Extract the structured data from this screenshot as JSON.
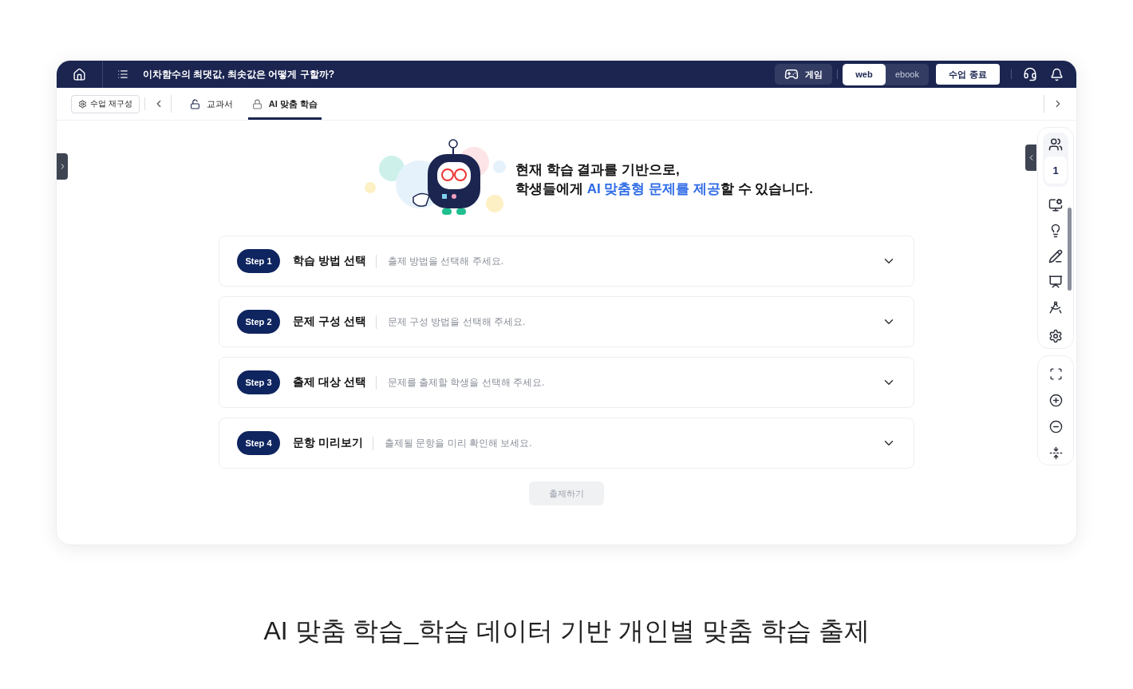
{
  "topbar": {
    "title": "이차함수의 최댓값, 최솟값은 어떻게 구할까?",
    "game_label": "게임",
    "views": [
      {
        "label": "web",
        "selected": true
      },
      {
        "label": "ebook",
        "selected": false
      }
    ],
    "end_button": "수업 종료"
  },
  "tabbar": {
    "reconfigure": "수업 재구성",
    "tabs": [
      {
        "label": "교과서",
        "selected": false,
        "locked": false
      },
      {
        "label": "AI 맞춤 학습",
        "selected": true,
        "locked": true
      }
    ]
  },
  "hero": {
    "line1": "현재 학습 결과를 기반으로,",
    "line2": [
      {
        "text": "학생들에게 ",
        "highlight": false
      },
      {
        "text": "AI 맞춤형 문제를 제공",
        "highlight": true
      },
      {
        "text": "할 수 있습니다.",
        "highlight": false
      }
    ]
  },
  "steps": [
    {
      "badge": "Step 1",
      "title": "학습 방법 선택",
      "hint": "출제 방법을 선택해 주세요."
    },
    {
      "badge": "Step 2",
      "title": "문제 구성 선택",
      "hint": "문제 구성 방법을 선택해 주세요."
    },
    {
      "badge": "Step 3",
      "title": "출제 대상 선택",
      "hint": "문제를 출제할 학생을 선택해 주세요."
    },
    {
      "badge": "Step 4",
      "title": "문항 미리보기",
      "hint": "출제될 문항을 미리 확인해 보세요."
    }
  ],
  "submit": {
    "label": "출제하기",
    "disabled": true
  },
  "side_rail": {
    "student_count": "1"
  },
  "caption": "AI 맞춤 학습_학습 데이터 기반 개인별 맞춤 학습 출제"
}
